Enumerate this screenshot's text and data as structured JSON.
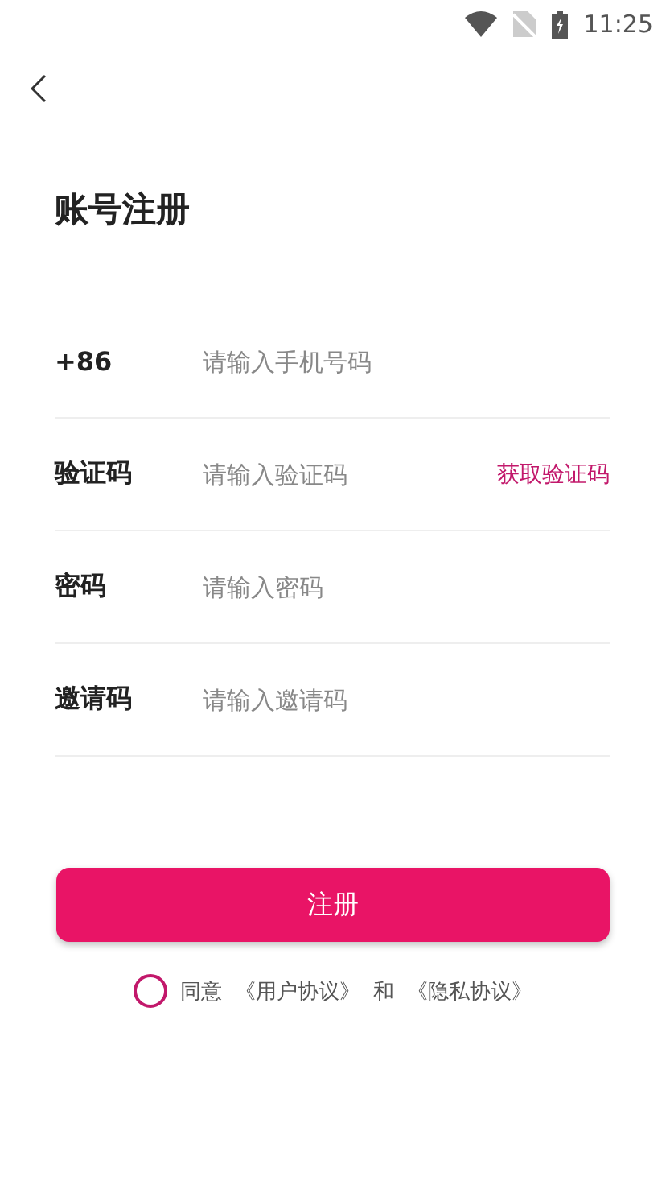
{
  "status_bar": {
    "time": "11:25"
  },
  "title": "账号注册",
  "fields": [
    {
      "label": "+86",
      "placeholder": "请输入手机号码"
    },
    {
      "label": "验证码",
      "placeholder": "请输入验证码",
      "action": "获取验证码"
    },
    {
      "label": "密码",
      "placeholder": "请输入密码"
    },
    {
      "label": "邀请码",
      "placeholder": "请输入邀请码"
    }
  ],
  "submit": "注册",
  "agreement": {
    "checked": false,
    "prefix": "同意",
    "user_agreement": "《用户协议》",
    "conjunction": "和",
    "privacy_agreement": "《隐私协议》"
  }
}
